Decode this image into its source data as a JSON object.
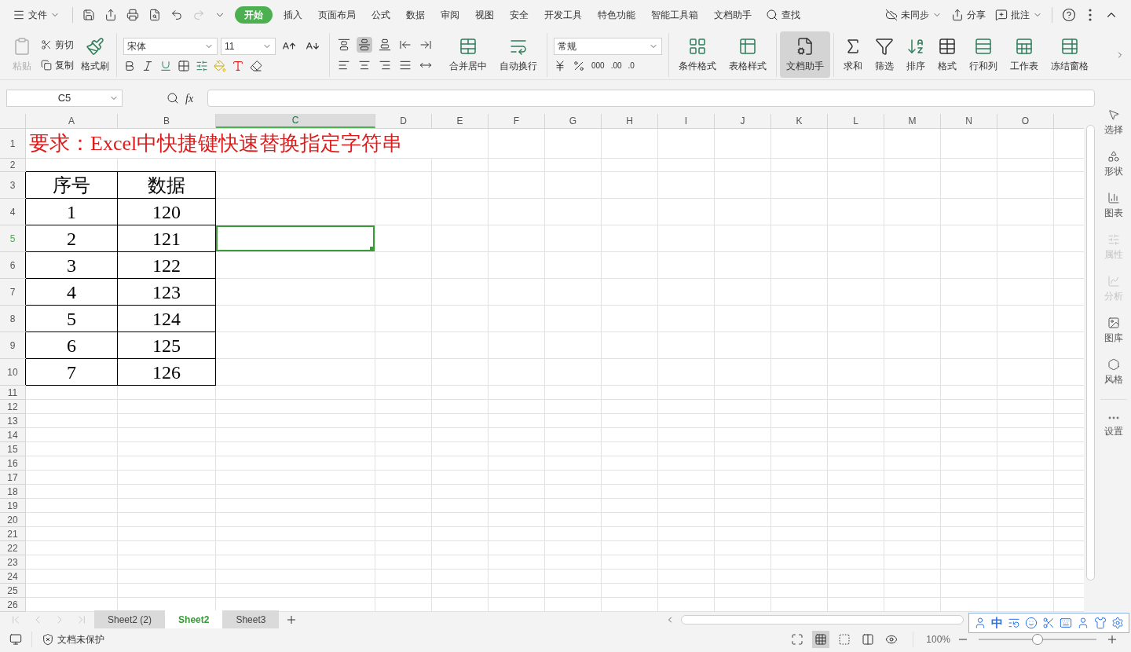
{
  "menu": {
    "file": "文件",
    "tabs": [
      {
        "label": "开始",
        "selected": true
      },
      {
        "label": "插入",
        "selected": false
      },
      {
        "label": "页面布局",
        "selected": false
      },
      {
        "label": "公式",
        "selected": false
      },
      {
        "label": "数据",
        "selected": false
      },
      {
        "label": "审阅",
        "selected": false
      },
      {
        "label": "视图",
        "selected": false
      },
      {
        "label": "安全",
        "selected": false
      },
      {
        "label": "开发工具",
        "selected": false
      },
      {
        "label": "特色功能",
        "selected": false
      },
      {
        "label": "智能工具箱",
        "selected": false
      },
      {
        "label": "文档助手",
        "selected": false
      }
    ],
    "search": "查找",
    "sync": "未同步",
    "share": "分享",
    "comment": "批注"
  },
  "ribbon": {
    "paste": {
      "label": "粘贴",
      "disabled": true
    },
    "cut": "剪切",
    "copy": "复制",
    "format_painter": "格式刷",
    "font": "宋体",
    "size": "11",
    "align": [
      {
        "kind": "top",
        "selected": false
      },
      {
        "kind": "middle",
        "selected": true
      },
      {
        "kind": "bottom",
        "selected": false
      },
      {
        "kind": "outdent",
        "selected": false
      },
      {
        "kind": "indent",
        "selected": false
      },
      {
        "kind": "left",
        "selected": false
      },
      {
        "kind": "center",
        "selected": false
      },
      {
        "kind": "right",
        "selected": false
      },
      {
        "kind": "justify",
        "selected": false
      },
      {
        "kind": "distribute",
        "selected": false
      }
    ],
    "merge": "合并居中",
    "wrap": "自动换行",
    "number_format": "常规",
    "thousands": "000",
    "decimal_add": ".00",
    "decimal_remove": ".0",
    "big_buttons": [
      {
        "kind": "conditional",
        "label": "条件格式",
        "selected": false
      },
      {
        "kind": "table_style",
        "label": "表格样式",
        "selected": false
      },
      {
        "kind": "assistant",
        "label": "文档助手",
        "selected": true
      },
      {
        "kind": "sum",
        "label": "求和",
        "selected": false
      },
      {
        "kind": "filter",
        "label": "筛选",
        "selected": false
      },
      {
        "kind": "sort",
        "label": "排序",
        "selected": false
      },
      {
        "kind": "format",
        "label": "格式",
        "selected": false
      },
      {
        "kind": "rows",
        "label": "行和列",
        "selected": false
      },
      {
        "kind": "sheet",
        "label": "工作表",
        "selected": false
      },
      {
        "kind": "freeze",
        "label": "冻结窗格",
        "selected": false
      }
    ]
  },
  "formula_bar": {
    "name_box": "C5",
    "fx": "fx"
  },
  "sheet": {
    "columns": [
      {
        "label": "A",
        "selected": false
      },
      {
        "label": "B",
        "selected": false
      },
      {
        "label": "C",
        "selected": true
      },
      {
        "label": "D",
        "selected": false
      },
      {
        "label": "E",
        "selected": false
      },
      {
        "label": "F",
        "selected": false
      },
      {
        "label": "G",
        "selected": false
      },
      {
        "label": "H",
        "selected": false
      },
      {
        "label": "I",
        "selected": false
      },
      {
        "label": "J",
        "selected": false
      },
      {
        "label": "K",
        "selected": false
      },
      {
        "label": "L",
        "selected": false
      },
      {
        "label": "M",
        "selected": false
      },
      {
        "label": "N",
        "selected": false
      },
      {
        "label": "O",
        "selected": false
      }
    ],
    "rows": [
      {
        "label": "1",
        "selected": false
      },
      {
        "label": "2",
        "selected": false
      },
      {
        "label": "3",
        "selected": false
      },
      {
        "label": "4",
        "selected": false
      },
      {
        "label": "5",
        "selected": true
      },
      {
        "label": "6",
        "selected": false
      },
      {
        "label": "7",
        "selected": false
      },
      {
        "label": "8",
        "selected": false
      },
      {
        "label": "9",
        "selected": false
      },
      {
        "label": "10",
        "selected": false
      },
      {
        "label": "11",
        "selected": false
      },
      {
        "label": "12",
        "selected": false
      },
      {
        "label": "13",
        "selected": false
      },
      {
        "label": "14",
        "selected": false
      },
      {
        "label": "15",
        "selected": false
      },
      {
        "label": "16",
        "selected": false
      },
      {
        "label": "17",
        "selected": false
      },
      {
        "label": "18",
        "selected": false
      },
      {
        "label": "19",
        "selected": false
      },
      {
        "label": "20",
        "selected": false
      },
      {
        "label": "21",
        "selected": false
      },
      {
        "label": "22",
        "selected": false
      },
      {
        "label": "23",
        "selected": false
      },
      {
        "label": "24",
        "selected": false
      },
      {
        "label": "25",
        "selected": false
      },
      {
        "label": "26",
        "selected": false
      }
    ],
    "title": "要求：Excel中快捷键快速替换指定字符串",
    "table_header": [
      "序号",
      "数据"
    ],
    "table_rows": [
      [
        "1",
        "120"
      ],
      [
        "2",
        "121"
      ],
      [
        "3",
        "122"
      ],
      [
        "4",
        "123"
      ],
      [
        "5",
        "124"
      ],
      [
        "6",
        "125"
      ],
      [
        "7",
        "126"
      ]
    ]
  },
  "sidebar": [
    {
      "kind": "select",
      "label": "选择",
      "disabled": false
    },
    {
      "kind": "shape",
      "label": "形状",
      "disabled": false
    },
    {
      "kind": "chart",
      "label": "图表",
      "disabled": false
    },
    {
      "kind": "property",
      "label": "属性",
      "disabled": true
    },
    {
      "kind": "analyze",
      "label": "分析",
      "disabled": true
    },
    {
      "kind": "gallery",
      "label": "图库",
      "disabled": false
    },
    {
      "kind": "style",
      "label": "风格",
      "disabled": false
    },
    {
      "kind": "settings",
      "label": "设置",
      "disabled": false
    }
  ],
  "sheet_tabs": [
    {
      "label": "Sheet2 (2)",
      "selected": false
    },
    {
      "label": "Sheet2",
      "selected": true
    },
    {
      "label": "Sheet3",
      "selected": false
    }
  ],
  "status": {
    "protection": "文档未保护",
    "zoom": "100%",
    "zoom_level": {
      "level": 0.5
    },
    "views": [
      {
        "kind": "fullscreen",
        "selected": false
      },
      {
        "kind": "normal",
        "selected": true
      },
      {
        "kind": "page_break",
        "selected": false
      },
      {
        "kind": "layout",
        "selected": false
      },
      {
        "kind": "eye",
        "selected": false
      }
    ]
  },
  "ime": {
    "label": "中"
  }
}
